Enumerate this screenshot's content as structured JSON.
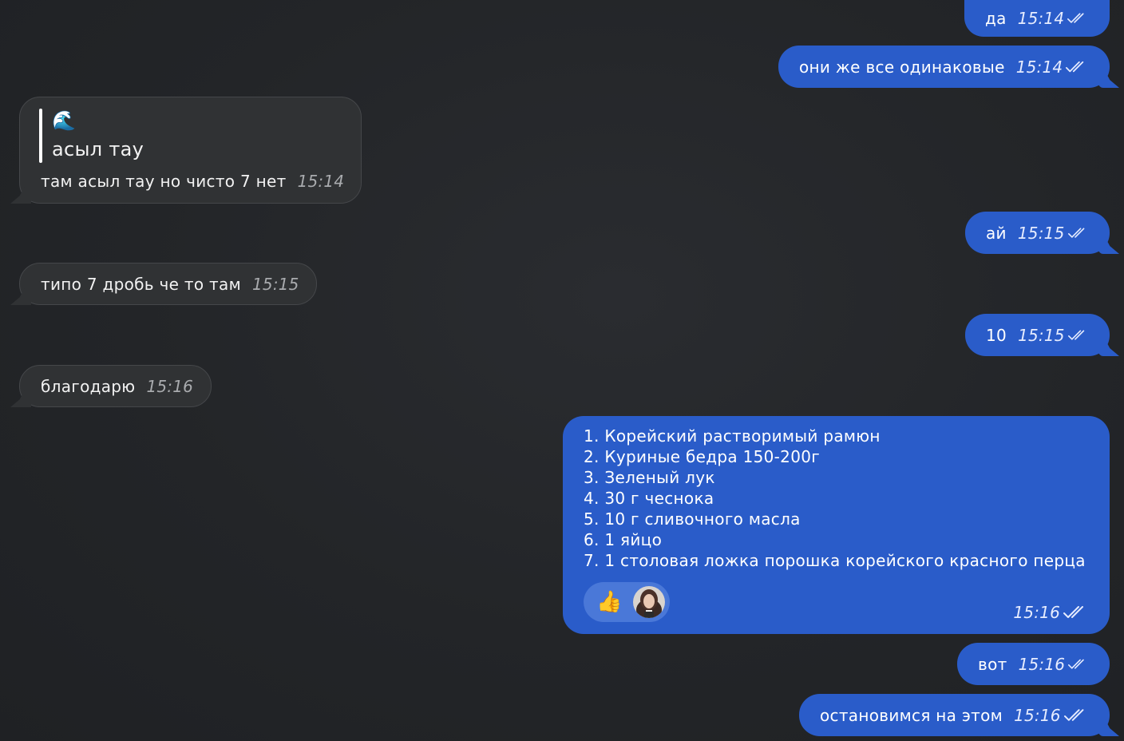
{
  "messages": {
    "m1": {
      "text": "да",
      "time": "15:14"
    },
    "m2": {
      "text": "они же все одинаковые",
      "time": "15:14"
    },
    "m3": {
      "quote_emoji": "🌊",
      "quote_text": "асыл тау",
      "text": "там асыл тау но чисто 7 нет",
      "time": "15:14"
    },
    "m4": {
      "text": "ай",
      "time": "15:15"
    },
    "m5": {
      "text": "типо 7 дробь че то там",
      "time": "15:15"
    },
    "m6": {
      "text": "10",
      "time": "15:15"
    },
    "m7": {
      "text": "благодарю",
      "time": "15:16"
    },
    "m8": {
      "lines": [
        "1. Корейский растворимый рамюн",
        "2. Куриные бедра 150-200г",
        "3. Зеленый лук",
        "4. 30 г чеснока",
        "5. 10 г сливочного масла",
        "6. 1 яйцо",
        "7. 1 столовая ложка порошка корейского красного перца"
      ],
      "reaction_emoji": "👍",
      "time": "15:16"
    },
    "m9": {
      "text": "вот",
      "time": "15:16"
    },
    "m10": {
      "text": "остановимся на этом",
      "time": "15:16"
    }
  },
  "colors": {
    "background": "#232528",
    "outgoing_bubble": "#2a5cc9",
    "incoming_bubble": "#303234",
    "reaction_pill": "#4a78d8"
  },
  "icons": {
    "read_status": "double-check-icon",
    "reaction_user": "avatar"
  }
}
